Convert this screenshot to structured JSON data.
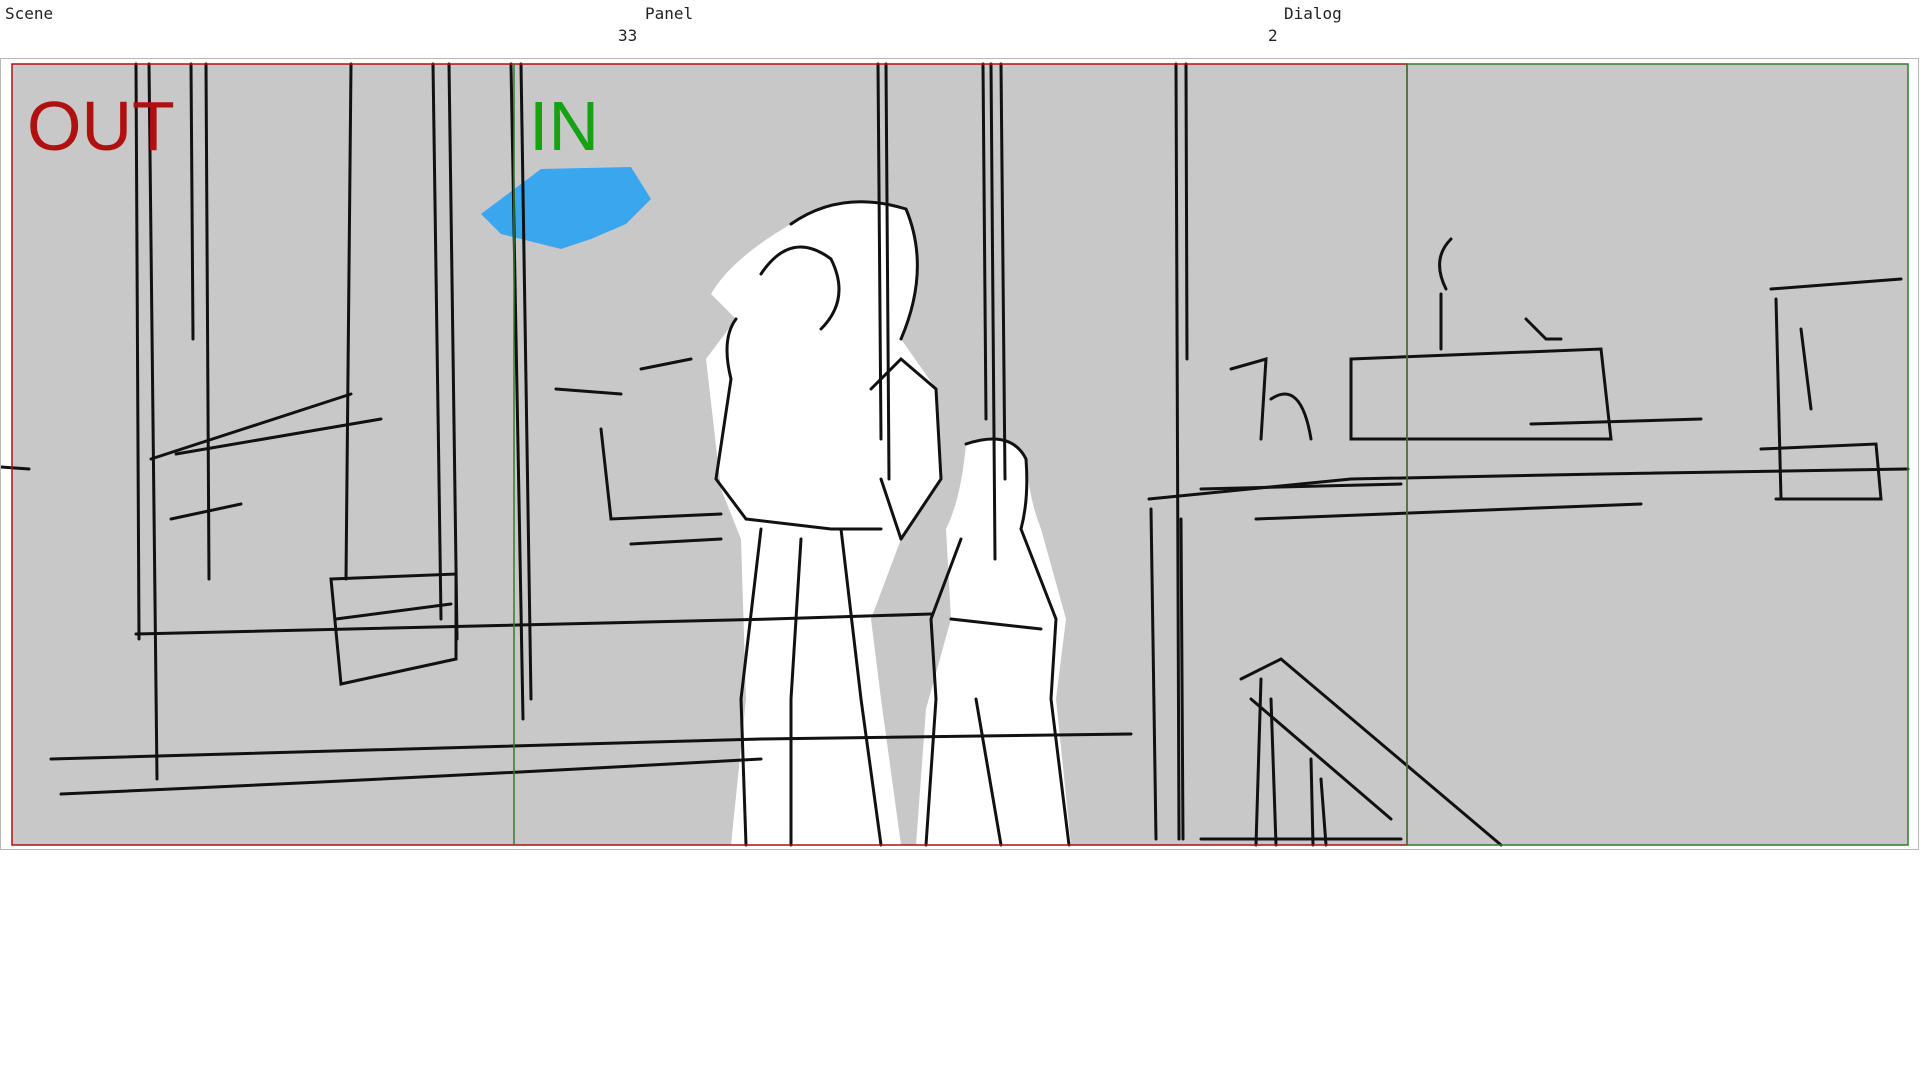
{
  "header": {
    "scene_label": "Scene",
    "panel_label": "Panel",
    "panel_value": "33",
    "dialog_label": "Dialog",
    "dialog_value": "2"
  },
  "panel": {
    "out_label": "OUT",
    "in_label": "IN",
    "colors": {
      "out": "#b01010",
      "in": "#13a313",
      "guide_green": "#2f7d2f",
      "sketch_bg": "#c8c8c8",
      "figure_fill": "#ffffff",
      "stroke": "#111111",
      "highlight": "#3aa6ee"
    }
  }
}
